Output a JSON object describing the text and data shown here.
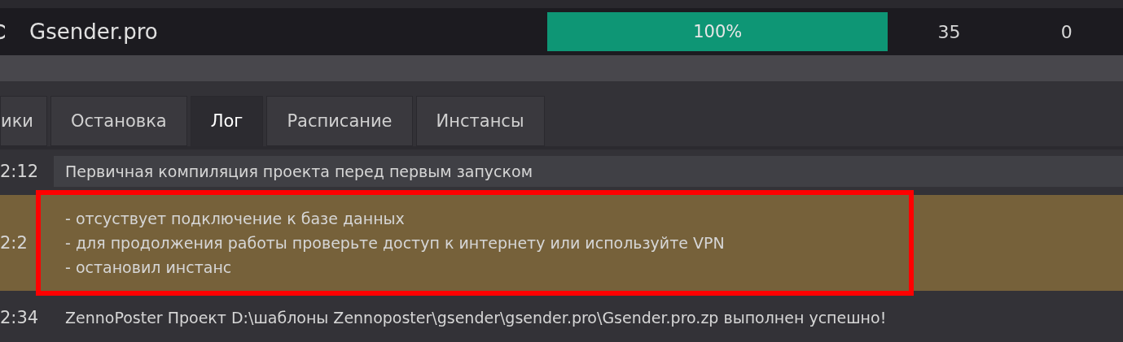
{
  "task_row": {
    "name": "Gsender.pro",
    "progress": {
      "level": 1,
      "label": "100%"
    },
    "column_3": "35",
    "column_4": "0"
  },
  "tabs": [
    {
      "label": "ики",
      "selected": false
    },
    {
      "label": "Остановка",
      "selected": false
    },
    {
      "label": "Лог",
      "selected": true
    },
    {
      "label": "Расписание",
      "selected": false
    },
    {
      "label": "Инстансы",
      "selected": false
    }
  ],
  "log": [
    {
      "time": "2:12",
      "kind": "info",
      "highlighted": false,
      "lines": [
        "Первичная компиляция проекта перед первым запуском"
      ]
    },
    {
      "time": "2:2",
      "kind": "warning",
      "highlighted": true,
      "lines": [
        "- отсуствует подключение к базе данных",
        "- для продолжения работы проверьте доступ к интернету или используйте VPN",
        "- остановил инстанс"
      ]
    },
    {
      "time": "2:34",
      "kind": "plain",
      "highlighted": false,
      "lines": [
        "ZennoPoster Проект D:\\шаблоны Zennoposter\\gsender\\gsender.pro\\Gsender.pro.zp выполнен успешно!"
      ]
    }
  ]
}
